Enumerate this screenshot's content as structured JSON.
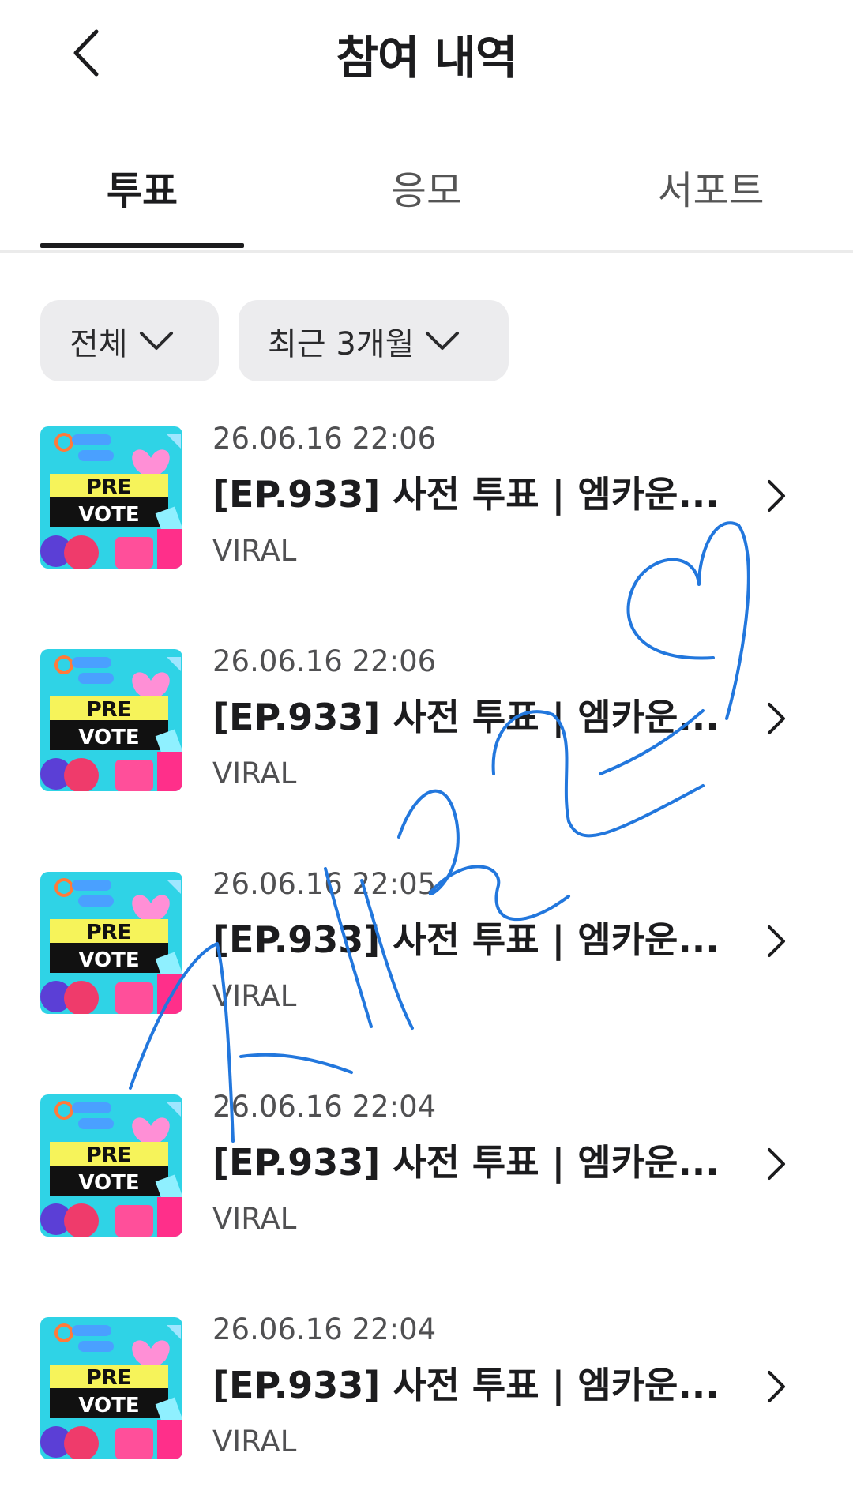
{
  "header": {
    "title": "참여 내역",
    "back_icon": "chevron-left-icon"
  },
  "tabs": [
    {
      "label": "투표",
      "active": true
    },
    {
      "label": "응모",
      "active": false
    },
    {
      "label": "서포트",
      "active": false
    }
  ],
  "filters": [
    {
      "label": "전체",
      "icon": "chevron-down-icon"
    },
    {
      "label": "최근 3개월",
      "icon": "chevron-down-icon"
    }
  ],
  "list": [
    {
      "date": "26.06.16 22:06",
      "title": "[EP.933] 사전 투표 | 엠카운...",
      "category": "VIRAL",
      "thumb_top": "PRE",
      "thumb_bottom": "VOTE"
    },
    {
      "date": "26.06.16 22:06",
      "title": "[EP.933] 사전 투표 | 엠카운...",
      "category": "VIRAL",
      "thumb_top": "PRE",
      "thumb_bottom": "VOTE"
    },
    {
      "date": "26.06.16 22:05",
      "title": "[EP.933] 사전 투표 | 엠카운...",
      "category": "VIRAL",
      "thumb_top": "PRE",
      "thumb_bottom": "VOTE"
    },
    {
      "date": "26.06.16 22:04",
      "title": "[EP.933] 사전 투표 | 엠카운...",
      "category": "VIRAL",
      "thumb_top": "PRE",
      "thumb_bottom": "VOTE"
    },
    {
      "date": "26.06.16 22:04",
      "title": "[EP.933] 사전 투표 | 엠카운...",
      "category": "VIRAL",
      "thumb_top": "PRE",
      "thumb_bottom": "VOTE"
    }
  ],
  "colors": {
    "ink": "#1c1c1e",
    "chip_bg": "#ececee",
    "scribble": "#2277dd",
    "thumb_bg": "#2fd3e6",
    "thumb_band": "#f6f35a"
  }
}
